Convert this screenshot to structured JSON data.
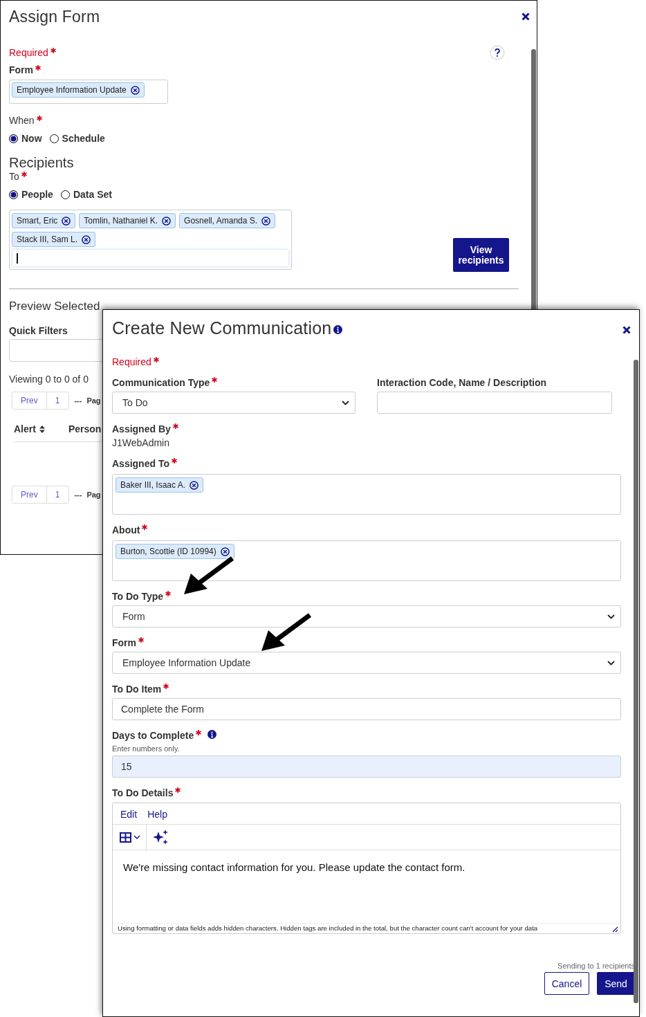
{
  "assign_form": {
    "title": "Assign Form",
    "required": "Required",
    "form": {
      "label": "Form",
      "required": true,
      "tags": [
        "Employee Information Update"
      ]
    },
    "when": {
      "label": "When",
      "required": true,
      "options": [
        {
          "label": "Now",
          "selected": true
        },
        {
          "label": "Schedule",
          "selected": false
        }
      ]
    },
    "recipients_heading": "Recipients",
    "to": {
      "label": "To",
      "required": true,
      "options": [
        {
          "label": "People",
          "selected": true
        },
        {
          "label": "Data Set",
          "selected": false
        }
      ]
    },
    "recipient_tags": [
      "Smart, Eric",
      "Tomlin, Nathaniel K.",
      "Gosnell, Amanda S.",
      "Stack III, Sam L."
    ],
    "view_button": "View recipients",
    "preview_heading": "Preview Selected",
    "quick_filters_label": "Quick Filters",
    "viewing": "Viewing 0 to 0 of 0",
    "pagers": [
      {
        "prev": "Prev",
        "page": "1",
        "ellipsis": "---",
        "page_label": "Pag"
      },
      {
        "prev": "Prev",
        "page": "1",
        "ellipsis": "---",
        "page_label": "Pag"
      }
    ],
    "columns": [
      {
        "label": "Alert",
        "sortable": true
      },
      {
        "label": "Person",
        "sortable": false
      }
    ]
  },
  "communication": {
    "title": "Create New Communication",
    "required": "Required",
    "communication_type": {
      "label": "Communication Type",
      "required": true,
      "value": "To Do"
    },
    "interaction": {
      "label": "Interaction Code, Name / Description",
      "required": false
    },
    "assigned_by": {
      "label": "Assigned By",
      "required": true,
      "value": "J1WebAdmin"
    },
    "assigned_to": {
      "label": "Assigned To",
      "required": true,
      "tags": [
        "Baker III, Isaac A."
      ]
    },
    "about": {
      "label": "About",
      "required": true,
      "tags": [
        "Burton, Scottie (ID 10994)"
      ]
    },
    "todo_type": {
      "label": "To Do Type",
      "required": true,
      "value": "Form"
    },
    "form": {
      "label": "Form",
      "required": true,
      "value": "Employee Information Update"
    },
    "todo_item": {
      "label": "To Do Item",
      "required": true,
      "value": "Complete the Form"
    },
    "days": {
      "label": "Days to Complete",
      "required": true,
      "hint": "Enter numbers only.",
      "value": "15"
    },
    "details": {
      "label": "To Do Details",
      "required": true,
      "menu": [
        "Edit",
        "Help"
      ],
      "body": "We're missing contact information for you. Please update the contact form.",
      "footer": "Using formatting or data fields adds hidden characters. Hidden tags are included in the total, but the character count can't account for your data"
    },
    "sending": "Sending to 1 recipients",
    "buttons": [
      {
        "label": "Cancel",
        "kind": "secondary"
      },
      {
        "label": "Send",
        "kind": "primary"
      }
    ]
  }
}
